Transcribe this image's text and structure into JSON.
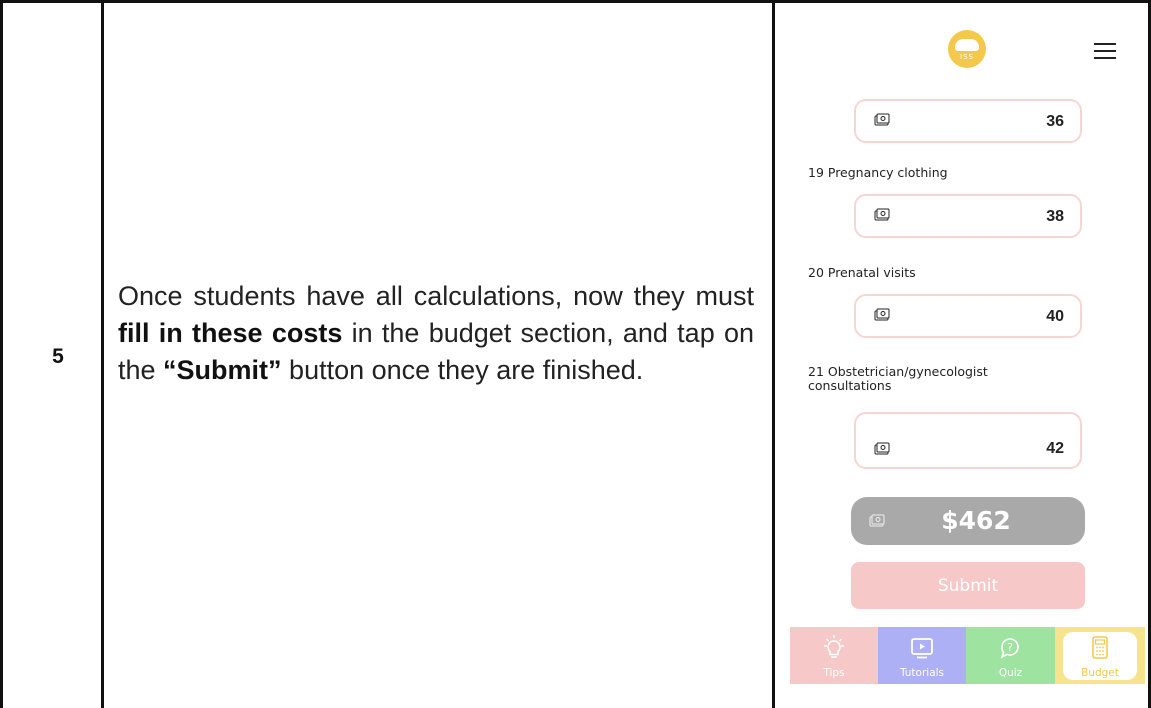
{
  "step": {
    "number": "5",
    "text_part1": "Once students have all calculations, now they must ",
    "text_bold1": "fill in these costs",
    "text_part2": " in the budget section, and tap on the ",
    "text_bold2": "“Submit”",
    "text_part3": " button once they are finished."
  },
  "phone": {
    "logo_text": "ISS",
    "items": [
      {
        "label": "",
        "value": "36"
      },
      {
        "label": "19 Pregnancy clothing",
        "value": "38"
      },
      {
        "label": "20 Prenatal visits",
        "value": "40"
      },
      {
        "label": "21 Obstetrician/gynecologist consultations",
        "value": "42"
      }
    ],
    "total": "$462",
    "submit_label": "Submit",
    "nav": [
      {
        "label": "Tips",
        "icon": "lightbulb-icon",
        "color": "#f6c9c8"
      },
      {
        "label": "Tutorials",
        "icon": "play-icon",
        "color": "#aeb0f5"
      },
      {
        "label": "Quiz",
        "icon": "question-icon",
        "color": "#9ee3a0"
      },
      {
        "label": "Budget",
        "icon": "calculator-icon",
        "color": "#f7e28d"
      }
    ]
  },
  "colors": {
    "field_border": "#f6d6d3",
    "total_bg": "#a9a9a9",
    "submit_bg": "#f6c9c8",
    "logo": "#f4c84a"
  }
}
